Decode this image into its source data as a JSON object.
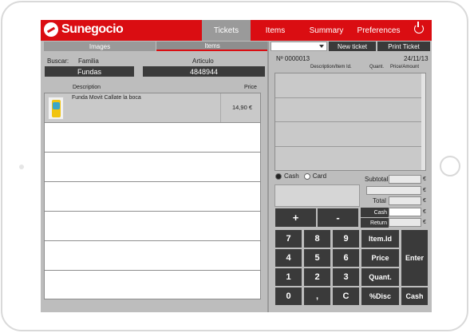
{
  "app": {
    "name": "Sunegocio"
  },
  "nav": {
    "tabs": [
      "Tickets",
      "Items",
      "Summary",
      "Preferences"
    ]
  },
  "left": {
    "segments": [
      "Images",
      "Items"
    ],
    "buscar_label": "Buscar:",
    "familia_label": "Familia",
    "familia_value": "Fundas",
    "articulo_label": "Articulo",
    "articulo_value": "4848944",
    "col_description": "Description",
    "col_price": "Price",
    "rows": [
      {
        "description": "Funda Movit Callate la boca",
        "price": "14,90 €"
      }
    ]
  },
  "ticket": {
    "new_ticket": "New ticket",
    "print_ticket": "Print Ticket",
    "number": "Nº 0000013",
    "date": "24/11/13",
    "col_desc": "Description/Item Id.",
    "col_quant": "Quant.",
    "col_price": "Price/Amount",
    "pay_cash": "Cash",
    "pay_card": "Card",
    "subtotal_label": "Subtotal",
    "total_label": "Total",
    "cash_label": "Cash",
    "return_label": "Return",
    "euro": "€"
  },
  "keypad": {
    "plus": "+",
    "minus": "-",
    "r1": [
      "7",
      "8",
      "9",
      "Item.Id"
    ],
    "r2": [
      "4",
      "5",
      "6",
      "Price"
    ],
    "r3": [
      "1",
      "2",
      "3",
      "Quant."
    ],
    "r4": [
      "0",
      ",",
      "C",
      "%Disc",
      "Cash"
    ],
    "enter": "Enter"
  },
  "colors": {
    "brand": "#da0d12",
    "panel": "#bdbdbd",
    "key": "#3a3a3a"
  }
}
